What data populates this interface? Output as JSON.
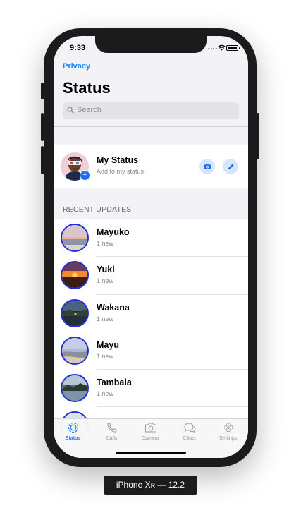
{
  "status_bar": {
    "time": "9:33"
  },
  "header": {
    "privacy_link": "Privacy",
    "title": "Status"
  },
  "search": {
    "placeholder": "Search"
  },
  "my_status": {
    "name": "My Status",
    "subtitle": "Add to my status"
  },
  "recent": {
    "section_title": "RECENT UPDATES",
    "items": [
      {
        "name": "Mayuko",
        "subtitle": "1 new"
      },
      {
        "name": "Yuki",
        "subtitle": "1 new"
      },
      {
        "name": "Wakana",
        "subtitle": "1 new"
      },
      {
        "name": "Mayu",
        "subtitle": "1 new"
      },
      {
        "name": "Tambala",
        "subtitle": "1 new"
      },
      {
        "name": "",
        "subtitle": ""
      }
    ]
  },
  "tabs": [
    {
      "label": "Status",
      "icon": "status-icon",
      "active": true
    },
    {
      "label": "Calls",
      "icon": "phone-icon",
      "active": false
    },
    {
      "label": "Camera",
      "icon": "camera-icon",
      "active": false
    },
    {
      "label": "Chats",
      "icon": "chat-bubbles-icon",
      "active": false
    },
    {
      "label": "Settings",
      "icon": "gear-icon",
      "active": false
    }
  ],
  "device_label": "iPhone Xʀ — 12.2",
  "colors": {
    "accent": "#1a82f7",
    "ring": "#1e2fd8",
    "badge": "#1a6fe8"
  }
}
